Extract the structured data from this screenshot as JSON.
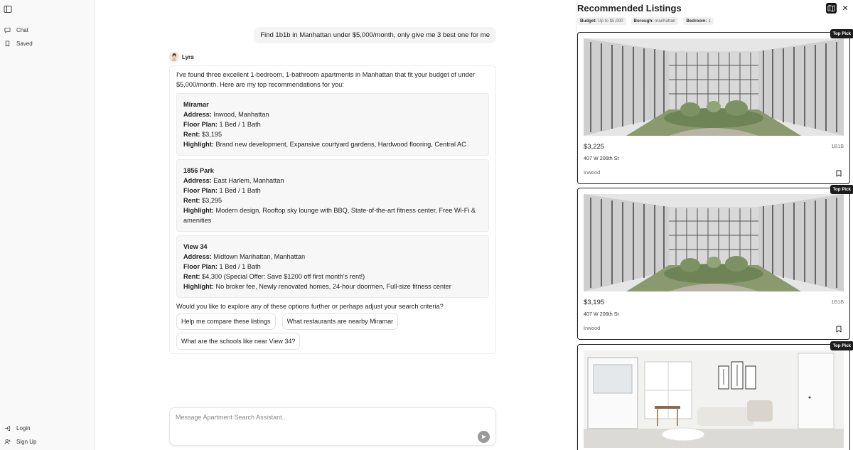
{
  "sidebar": {
    "items": [
      {
        "label": "Chat",
        "icon": "chat-icon"
      },
      {
        "label": "Saved",
        "icon": "bookmark-icon"
      }
    ],
    "bottom": [
      {
        "label": "Login",
        "icon": "login-icon"
      },
      {
        "label": "Sign Up",
        "icon": "user-plus-icon"
      }
    ]
  },
  "chat": {
    "user_message": "Find 1b1b in Manhattan under $5,000/month, only give me 3 best one for me",
    "assistant_name": "Lyra",
    "intro": "I've found three excellent 1-bedroom, 1-bathroom apartments in Manhattan that fit your budget of under $5,000/month. Here are my top recommendations for you:",
    "labels": {
      "address": "Address:",
      "floor_plan": "Floor Plan:",
      "rent": "Rent:",
      "highlight": "Highlight:"
    },
    "recommendations": [
      {
        "name": "Miramar",
        "address": "Inwood, Manhattan",
        "floor_plan": "1 Bed / 1 Bath",
        "rent": "$3,195",
        "highlight": "Brand new development, Expansive courtyard gardens, Hardwood flooring, Central AC"
      },
      {
        "name": "1856 Park",
        "address": "East Harlem, Manhattan",
        "floor_plan": "1 Bed / 1 Bath",
        "rent": "$3,295",
        "highlight": "Modern design, Rooftop sky lounge with BBQ, State-of-the-art fitness center, Free Wi-Fi & amenities"
      },
      {
        "name": "View 34",
        "address": "Midtown Manhattan, Manhattan",
        "floor_plan": "1 Bed / 1 Bath",
        "rent": "$4,300 (Special Offer: Save $1200 off first month's rent!)",
        "highlight": "No broker fee, Newly renovated homes, 24-hour doormen, Full-size fitness center"
      }
    ],
    "followup": "Would you like to explore any of these options further or perhaps adjust your search criteria?",
    "suggestions": [
      "Help me compare these listings",
      "What restaurants are nearby Miramar",
      "What are the schools like near View 34?"
    ],
    "composer_placeholder": "Message Apartment Search Assistant..."
  },
  "panel": {
    "title": "Recommended Listings",
    "filters": [
      {
        "label": "Budget:",
        "value": "Up to $5,000"
      },
      {
        "label": "Borough:",
        "value": "manhattan"
      },
      {
        "label": "Bedroom:",
        "value": "1"
      }
    ],
    "listings": [
      {
        "badge": "Top Pick",
        "price": "$3,225",
        "type": "1B1B",
        "address": "407 W 206th St",
        "neighborhood": "Inwood",
        "photo": "courtyard"
      },
      {
        "badge": "Top Pick",
        "price": "$3,195",
        "type": "1B1B",
        "address": "407 W 206th St",
        "neighborhood": "Inwood",
        "photo": "courtyard"
      },
      {
        "badge": "Top Pick",
        "price": "",
        "type": "",
        "address": "",
        "neighborhood": "",
        "photo": "interior"
      }
    ]
  }
}
